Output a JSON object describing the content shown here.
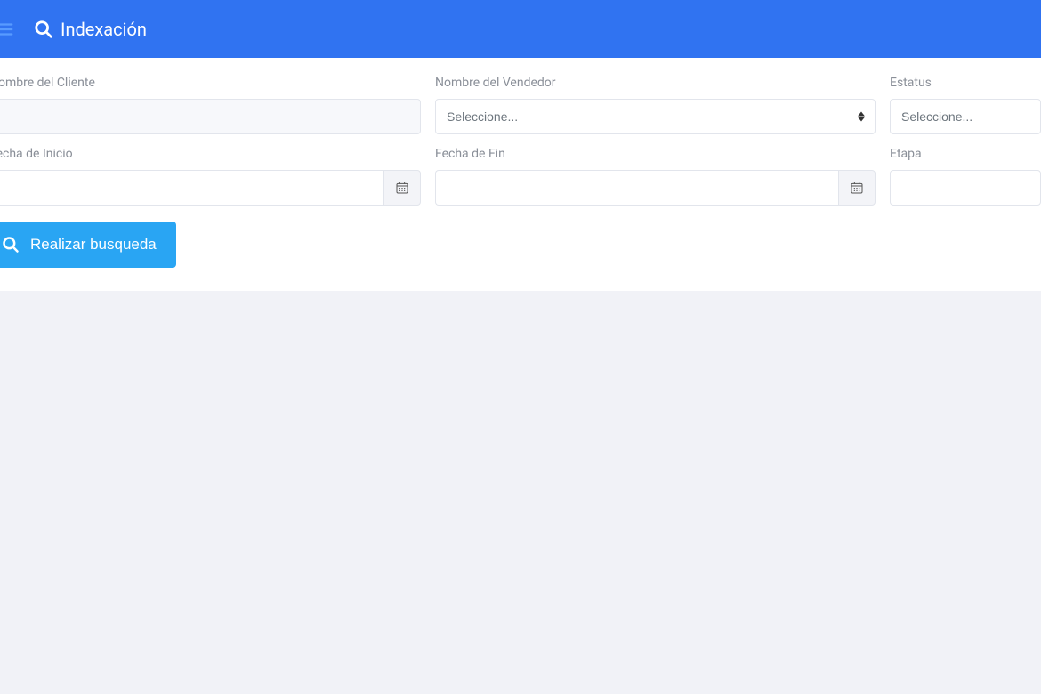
{
  "header": {
    "title": "Indexación"
  },
  "filters": {
    "client_name": {
      "label": "Nombre del Cliente",
      "value": ""
    },
    "seller_name": {
      "label": "Nombre del Vendedor",
      "placeholder": "Seleccione..."
    },
    "status": {
      "label": "Estatus",
      "placeholder": "Seleccione..."
    },
    "start_date": {
      "label": "Fecha de Inicio",
      "value": ""
    },
    "end_date": {
      "label": "Fecha de Fin",
      "value": ""
    },
    "stage": {
      "label": "Etapa",
      "value": ""
    }
  },
  "actions": {
    "search_label": "Realizar busqueda"
  }
}
